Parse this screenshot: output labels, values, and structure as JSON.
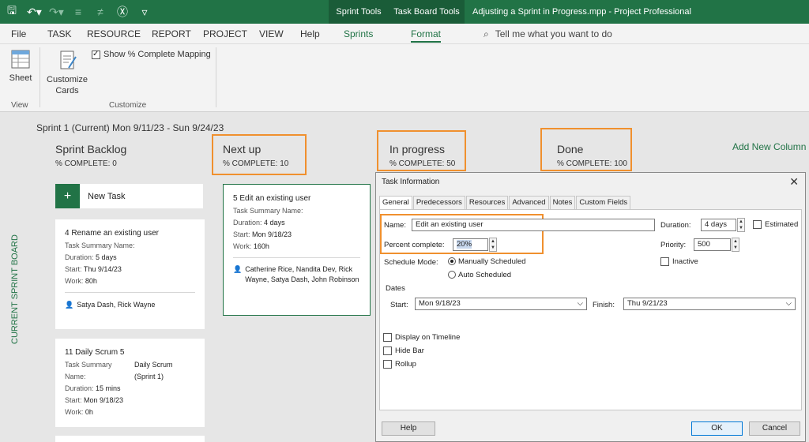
{
  "titlebar": {
    "context_tabs": [
      "Sprint Tools",
      "Task Board Tools"
    ],
    "window_title": "Adjusting a Sprint in Progress.mpp  -  Project Professional"
  },
  "menu": {
    "items": [
      "File",
      "TASK",
      "RESOURCE",
      "REPORT",
      "PROJECT",
      "VIEW",
      "Help",
      "Sprints",
      "Format"
    ],
    "tell_me": "Tell me what you want to do"
  },
  "ribbon": {
    "sheet_label": "Sheet",
    "customize_cards_label": "Customize\nCards",
    "show_mapping_label": "Show % Complete Mapping",
    "group_view": "View",
    "group_customize": "Customize"
  },
  "board": {
    "vertical_label": "CURRENT SPRINT BOARD",
    "sprint_title": "Sprint 1 (Current)   Mon 9/11/23 - Sun 9/24/23",
    "add_column": "Add New Column",
    "new_task": "New Task",
    "columns": [
      {
        "title": "Sprint Backlog",
        "pct": "% COMPLETE: 0"
      },
      {
        "title": "Next up",
        "pct": "% COMPLETE: 10"
      },
      {
        "title": "In progress",
        "pct": "% COMPLETE: 50"
      },
      {
        "title": "Done",
        "pct": "% COMPLETE: 100"
      }
    ],
    "cards": [
      {
        "title": "4  Rename an existing user",
        "summary_label": "Task Summary Name:",
        "duration_label": "Duration:",
        "duration": "5 days",
        "start_label": "Start:",
        "start": "Thu 9/14/23",
        "work_label": "Work:",
        "work": "80h",
        "people": "Satya Dash, Rick Wayne"
      },
      {
        "title": "11  Daily Scrum 5",
        "summary_label": "Task Summary Name:",
        "summary": "Daily Scrum (Sprint 1)",
        "duration_label": "Duration:",
        "duration": "15 mins",
        "start_label": "Start:",
        "start": "Mon 9/18/23",
        "work_label": "Work:",
        "work": "0h"
      },
      {
        "title": "5  Edit an existing user",
        "summary_label": "Task Summary Name:",
        "duration_label": "Duration:",
        "duration": "4 days",
        "start_label": "Start:",
        "start": "Mon 9/18/23",
        "work_label": "Work:",
        "work": "160h",
        "people": "Catherine Rice, Nandita Dev, Rick Wayne, Satya Dash, John Robinson"
      }
    ]
  },
  "dialog": {
    "title": "Task Information",
    "tabs": [
      "General",
      "Predecessors",
      "Resources",
      "Advanced",
      "Notes",
      "Custom Fields"
    ],
    "name_label": "Name:",
    "name_value": "Edit an existing user",
    "duration_label": "Duration:",
    "duration_value": "4 days",
    "estimated_label": "Estimated",
    "percent_label": "Percent complete:",
    "percent_value": "20%",
    "priority_label": "Priority:",
    "priority_value": "500",
    "schedule_mode_label": "Schedule Mode:",
    "manual_label": "Manually Scheduled",
    "auto_label": "Auto Scheduled",
    "inactive_label": "Inactive",
    "dates_label": "Dates",
    "start_label": "Start:",
    "start_value": "Mon 9/18/23",
    "finish_label": "Finish:",
    "finish_value": "Thu 9/21/23",
    "timeline_label": "Display on Timeline",
    "hidebar_label": "Hide Bar",
    "rollup_label": "Rollup",
    "help_label": "Help",
    "ok_label": "OK",
    "cancel_label": "Cancel"
  },
  "colors": {
    "accent": "#217346",
    "highlight": "#f0902e"
  }
}
